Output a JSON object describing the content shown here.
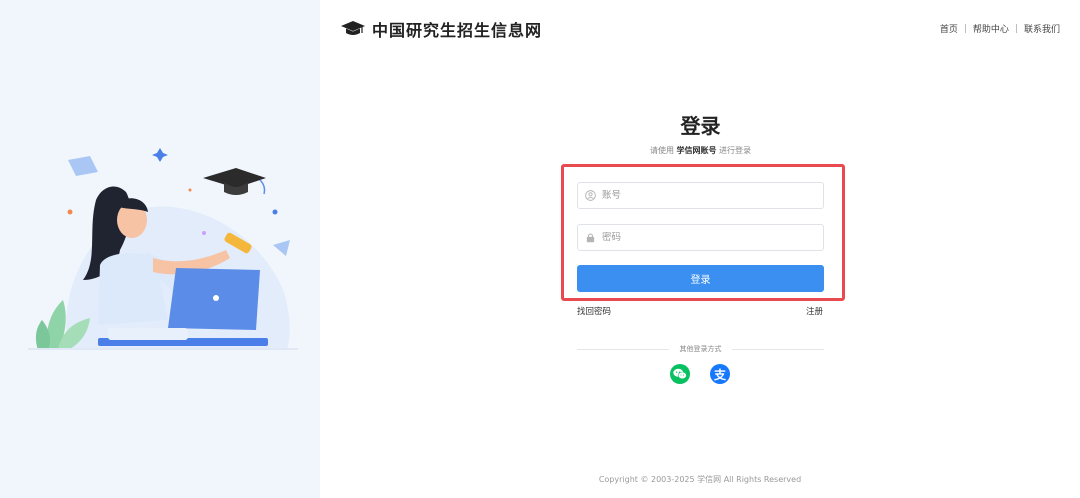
{
  "brand": {
    "title": "中国研究生招生信息网",
    "logo_icon": "graduation-cap-icon"
  },
  "top_nav": {
    "items": [
      {
        "label": "首页"
      },
      {
        "label": "帮助中心"
      },
      {
        "label": "联系我们"
      }
    ],
    "separator": "|"
  },
  "login": {
    "heading": "登录",
    "subtitle_prefix": "请使用",
    "subtitle_account": "学信网账号",
    "subtitle_suffix": "进行登录",
    "account_placeholder": "账号",
    "account_value": "",
    "password_placeholder": "密码",
    "password_value": "",
    "submit_label": "登录",
    "recover_label": "找回密码",
    "register_label": "注册",
    "other_methods_label": "其他登录方式",
    "highlight_color": "#e84a4f"
  },
  "social": {
    "wechat_icon": "wechat-icon",
    "alipay_glyph": "支"
  },
  "footer": {
    "copyright": "Copyright © 2003-2025  学信网  All Rights Reserved"
  },
  "colors": {
    "primary": "#3a8ff0",
    "left_panel_bg": "#f1f6fd",
    "wechat": "#07c160",
    "alipay": "#1677ff"
  }
}
